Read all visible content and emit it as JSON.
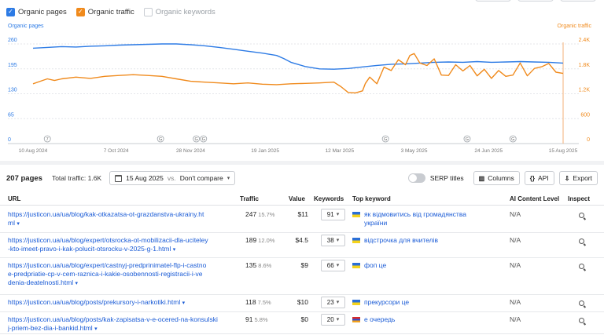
{
  "legend": {
    "organic_pages": "Organic pages",
    "organic_traffic": "Organic traffic",
    "organic_keywords": "Organic keywords"
  },
  "colors": {
    "pages": "#2d7be5",
    "traffic": "#f08a1c",
    "link": "#1a5bd6"
  },
  "chart_data": {
    "type": "line",
    "left_axis_title": "Organic pages",
    "right_axis_title": "Organic traffic",
    "left_ticks": [
      "260",
      "195",
      "130",
      "65",
      "0"
    ],
    "right_ticks": [
      "2.4K",
      "1.8K",
      "1.2K",
      "600",
      "0"
    ],
    "x_ticks": [
      "10 Aug 2024",
      "7 Oct 2024",
      "28 Nov 2024",
      "19 Jan 2025",
      "12 Mar 2025",
      "3 May 2025",
      "24 Jun 2025",
      "15 Aug 2025"
    ],
    "x_tick_days": [
      0,
      58,
      110,
      162,
      214,
      266,
      318,
      370
    ],
    "annotations": [
      {
        "label": "7",
        "day": 10
      },
      {
        "label": "G",
        "day": 89
      },
      {
        "label": "G",
        "day": 114
      },
      {
        "label": "G",
        "day": 119
      },
      {
        "label": "G",
        "day": 246
      },
      {
        "label": "G",
        "day": 303
      },
      {
        "label": "G",
        "day": 335
      }
    ],
    "ylim_left": [
      0,
      260
    ],
    "ylim_right": [
      0,
      2400
    ],
    "grid": true,
    "series": [
      {
        "name": "Organic pages",
        "axis": "left",
        "points": [
          [
            0,
            249
          ],
          [
            10,
            251
          ],
          [
            20,
            253
          ],
          [
            30,
            252
          ],
          [
            40,
            254
          ],
          [
            50,
            255
          ],
          [
            60,
            257
          ],
          [
            70,
            258
          ],
          [
            80,
            259
          ],
          [
            90,
            260
          ],
          [
            100,
            260
          ],
          [
            110,
            258
          ],
          [
            120,
            255
          ],
          [
            130,
            251
          ],
          [
            140,
            246
          ],
          [
            150,
            241
          ],
          [
            160,
            236
          ],
          [
            170,
            230
          ],
          [
            175,
            222
          ],
          [
            180,
            212
          ],
          [
            190,
            201
          ],
          [
            200,
            195
          ],
          [
            210,
            194
          ],
          [
            220,
            196
          ],
          [
            230,
            200
          ],
          [
            240,
            204
          ],
          [
            250,
            207
          ],
          [
            260,
            208
          ],
          [
            270,
            210
          ],
          [
            280,
            212
          ],
          [
            290,
            213
          ],
          [
            300,
            212
          ],
          [
            310,
            214
          ],
          [
            320,
            212
          ],
          [
            330,
            213
          ],
          [
            340,
            214
          ],
          [
            350,
            213
          ],
          [
            360,
            212
          ],
          [
            370,
            210
          ]
        ]
      },
      {
        "name": "Organic traffic",
        "axis": "right",
        "points": [
          [
            0,
            1440
          ],
          [
            5,
            1500
          ],
          [
            10,
            1560
          ],
          [
            15,
            1520
          ],
          [
            20,
            1560
          ],
          [
            30,
            1600
          ],
          [
            40,
            1570
          ],
          [
            50,
            1620
          ],
          [
            60,
            1640
          ],
          [
            70,
            1660
          ],
          [
            80,
            1640
          ],
          [
            90,
            1620
          ],
          [
            100,
            1560
          ],
          [
            110,
            1500
          ],
          [
            120,
            1480
          ],
          [
            130,
            1460
          ],
          [
            140,
            1440
          ],
          [
            150,
            1460
          ],
          [
            160,
            1430
          ],
          [
            170,
            1420
          ],
          [
            180,
            1440
          ],
          [
            190,
            1450
          ],
          [
            200,
            1460
          ],
          [
            210,
            1480
          ],
          [
            215,
            1370
          ],
          [
            220,
            1230
          ],
          [
            225,
            1220
          ],
          [
            230,
            1270
          ],
          [
            232,
            1450
          ],
          [
            235,
            1600
          ],
          [
            240,
            1440
          ],
          [
            245,
            1840
          ],
          [
            250,
            1760
          ],
          [
            255,
            2020
          ],
          [
            260,
            1900
          ],
          [
            263,
            2120
          ],
          [
            266,
            2170
          ],
          [
            270,
            1940
          ],
          [
            275,
            1880
          ],
          [
            280,
            2040
          ],
          [
            285,
            1650
          ],
          [
            290,
            1640
          ],
          [
            295,
            1900
          ],
          [
            300,
            1750
          ],
          [
            305,
            1880
          ],
          [
            310,
            1630
          ],
          [
            315,
            1790
          ],
          [
            320,
            1570
          ],
          [
            325,
            1760
          ],
          [
            330,
            1620
          ],
          [
            335,
            1650
          ],
          [
            340,
            1940
          ],
          [
            345,
            1630
          ],
          [
            350,
            1810
          ],
          [
            355,
            1850
          ],
          [
            360,
            1930
          ],
          [
            365,
            1720
          ],
          [
            370,
            1690
          ]
        ]
      }
    ]
  },
  "toolbar": {
    "pages_count": "207 pages",
    "total_traffic": "Total traffic: 1.6K",
    "date": "15 Aug 2025",
    "vs": "vs.",
    "compare": "Don't compare",
    "serp_titles": "SERP titles",
    "columns": "Columns",
    "api": "API",
    "api_icon": "{}",
    "export": "Export"
  },
  "table": {
    "headers": {
      "url": "URL",
      "traffic": "Traffic",
      "value": "Value",
      "keywords": "Keywords",
      "top_keyword": "Top keyword",
      "ai": "AI Content Level",
      "inspect": "Inspect"
    },
    "rows": [
      {
        "url_lines": [
          "https://justicon.ua/ua/blog/kak-otkazatsa-ot-grazdanstva-ukrainy.ht",
          "ml"
        ],
        "traffic": "247",
        "pct": "15.7%",
        "value": "$11",
        "keywords": "91",
        "flag": "ua",
        "top_keyword_lines": [
          "як відмовитись від громадянства",
          "україни"
        ],
        "ai": "N/A"
      },
      {
        "url_lines": [
          "https://justicon.ua/ua/blog/expert/otsrocka-ot-mobilizacii-dla-uciteley",
          "-kto-imeet-pravo-i-kak-polucit-otsrocku-v-2025-g-1.html"
        ],
        "traffic": "189",
        "pct": "12.0%",
        "value": "$4.5",
        "keywords": "38",
        "flag": "ua",
        "top_keyword_lines": [
          "відстрочка для вчителів"
        ],
        "ai": "N/A"
      },
      {
        "url_lines": [
          "https://justicon.ua/ua/blog/expert/castnyj-predprinimatel-flp-i-castno",
          "e-predpriatie-cp-v-cem-raznica-i-kakie-osobennosti-registracii-i-ve",
          "denia-deatelnosti.html"
        ],
        "traffic": "135",
        "pct": "8.6%",
        "value": "$9",
        "keywords": "66",
        "flag": "ua",
        "top_keyword_lines": [
          "фоп це"
        ],
        "ai": "N/A"
      },
      {
        "url_lines": [
          "https://justicon.ua/ua/blog/posts/prekursory-i-narkotiki.html"
        ],
        "traffic": "118",
        "pct": "7.5%",
        "value": "$10",
        "keywords": "23",
        "flag": "ua",
        "top_keyword_lines": [
          "прекурсори це"
        ],
        "ai": "N/A"
      },
      {
        "url_lines": [
          "https://justicon.ua/ua/blog/posts/kak-zapisatsa-v-e-ocered-na-konsulski",
          "j-priem-bez-dia-i-bankid.html"
        ],
        "traffic": "91",
        "pct": "5.8%",
        "value": "$0",
        "keywords": "20",
        "flag": "am",
        "top_keyword_lines": [
          "е очередь"
        ],
        "ai": "N/A"
      }
    ]
  }
}
